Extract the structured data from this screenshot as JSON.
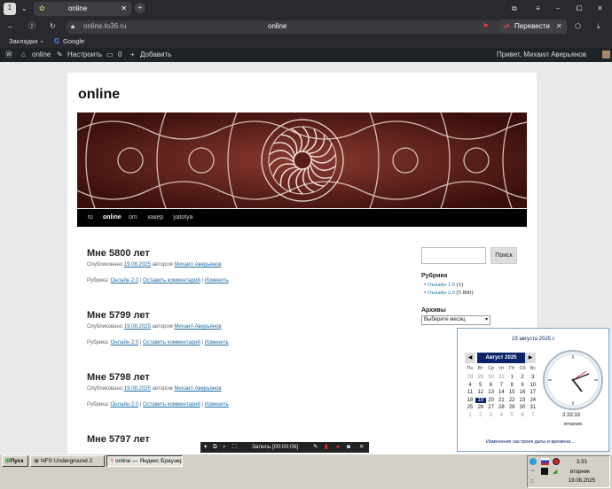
{
  "browser": {
    "tab_count": "1",
    "tab_title": "online",
    "url": "online.to36.ru",
    "page_title": "online",
    "translate_label": "Перевести",
    "bookmarks_label": "Закладки",
    "bookmark_google": "Google"
  },
  "wpbar": {
    "site": "online",
    "customize": "Настроить",
    "comments": "0",
    "add": "Добавить",
    "greeting": "Привет, Михаил Аверьянов"
  },
  "site": {
    "title": "online",
    "nav": [
      "to",
      "online",
      "om",
      "хакер",
      "yatotya"
    ]
  },
  "posts": [
    {
      "title": "Мне 5800 лет",
      "published": "Опубликовано",
      "date": "19.08.2025",
      "by": "автором",
      "author": "Михаил Аверьянов",
      "rubric": "Рубрика:",
      "category": "Онлайн 2.0",
      "comment": "Оставить комментарий",
      "edit": "Изменить"
    },
    {
      "title": "Мне 5799 лет",
      "published": "Опубликовано",
      "date": "19.08.2025",
      "by": "автором",
      "author": "Михаил Аверьянов",
      "rubric": "Рубрика:",
      "category": "Онлайн 2.0",
      "comment": "Оставить комментарий",
      "edit": "Изменить"
    },
    {
      "title": "Мне 5798 лет",
      "published": "Опубликовано",
      "date": "19.08.2025",
      "by": "автором",
      "author": "Михаил Аверьянов",
      "rubric": "Рубрика:",
      "category": "Онлайн 2.0",
      "comment": "Оставить комментарий",
      "edit": "Изменить"
    },
    {
      "title": "Мне 5797 лет"
    }
  ],
  "sidebar": {
    "search_button": "Поиск",
    "categories_title": "Рубрики",
    "categories": [
      {
        "name": "Онлайн 1.0",
        "count": "(1)"
      },
      {
        "name": "Онлайн 2.0",
        "count": "(5 800)"
      }
    ],
    "archives_title": "Архивы",
    "archives_select": "Выберите месяц"
  },
  "recorder": {
    "label": "Запись [00:00:06]"
  },
  "clock": {
    "date_long": "19 августа 2025 г.",
    "month": "Август 2025",
    "dow": [
      "Пн",
      "Вт",
      "Ср",
      "Чт",
      "Пт",
      "Сб",
      "Вс"
    ],
    "weeks": [
      [
        "28",
        "29",
        "30",
        "31",
        "1",
        "2",
        "3"
      ],
      [
        "4",
        "5",
        "6",
        "7",
        "8",
        "9",
        "10"
      ],
      [
        "11",
        "12",
        "13",
        "14",
        "15",
        "16",
        "17"
      ],
      [
        "18",
        "19",
        "20",
        "21",
        "22",
        "23",
        "24"
      ],
      [
        "25",
        "26",
        "27",
        "28",
        "29",
        "30",
        "31"
      ],
      [
        "1",
        "2",
        "3",
        "4",
        "5",
        "6",
        "7"
      ]
    ],
    "selected": "19",
    "time": "3:33:33",
    "weekday": "вторник",
    "settings_link": "Изменение настроек даты и времени..."
  },
  "taskbar": {
    "start": "Пуск",
    "items": [
      "NFS Underground 2",
      "online — Яндекс Браузер"
    ],
    "tray_time": "3:33",
    "tray_day": "вторник",
    "tray_date": "19.08.2025"
  },
  "colors": {
    "accent": "#1e6ea6",
    "banner": "#5b1c18",
    "calendar": "#0a246a"
  }
}
